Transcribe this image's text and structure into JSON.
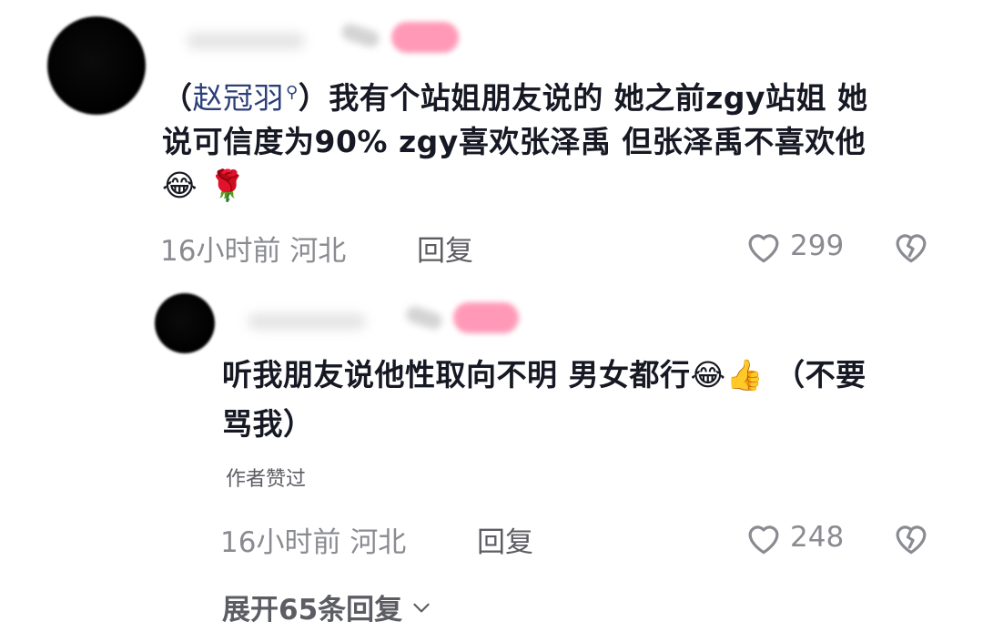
{
  "comment": {
    "mention": "赵冠羽",
    "line1_prefix": "（",
    "line1_suffix": "）我有个站姐朋友说的  她之前zgy站姐  她",
    "line2": "说可信度为90%  zgy喜欢张泽禹  但张泽禹不喜欢他",
    "line3": "😂 🌹",
    "time": "16小时前",
    "location": "河北",
    "reply_label": "回复",
    "likes": "299"
  },
  "reply": {
    "line1": "听我朋友说他性取向不明  男女都行😂👍 （不要",
    "line2": "骂我）",
    "liked_by_author": "作者赞过",
    "time": "16小时前",
    "location": "河北",
    "reply_label": "回复",
    "likes": "248"
  },
  "expand": {
    "label": "展开65条回复"
  },
  "colors": {
    "mention": "#2c3f7a",
    "meta": "#8a8b91",
    "reply_text": "#5c5d63",
    "text": "#161823",
    "badge_pink": "#ff8fb0"
  },
  "icons": {
    "like": "heart-outline-icon",
    "dislike": "broken-heart-icon",
    "expand": "chevron-down-icon",
    "mention_search": "search-icon"
  }
}
